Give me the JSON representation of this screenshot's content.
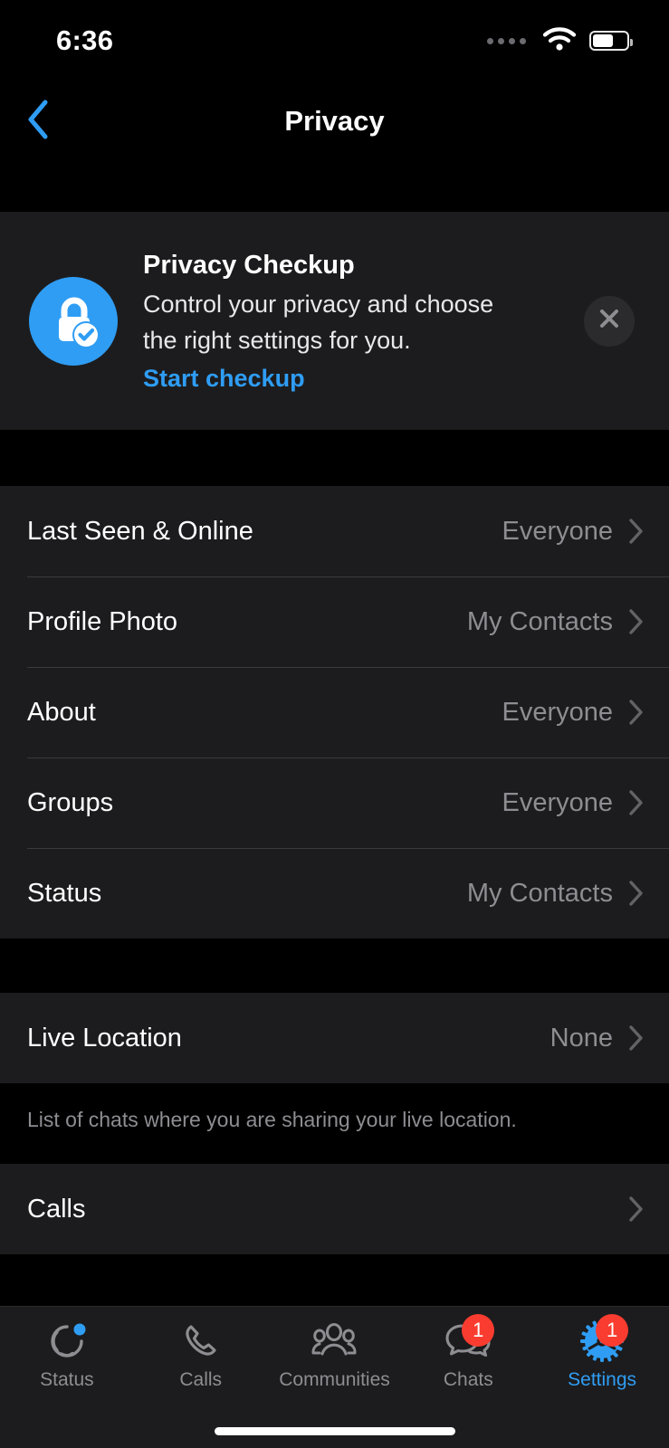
{
  "status_bar": {
    "time": "6:36",
    "signal_icon": "signal-dots-icon",
    "wifi_icon": "wifi-icon",
    "battery_icon": "battery-icon"
  },
  "nav": {
    "back_icon": "chevron-left-icon",
    "title": "Privacy"
  },
  "checkup": {
    "icon": "lock-check-icon",
    "title": "Privacy Checkup",
    "description": "Control your privacy and choose the right settings for you.",
    "link": "Start checkup",
    "close_icon": "close-icon"
  },
  "sections": [
    {
      "rows": [
        {
          "label": "Last Seen & Online",
          "value": "Everyone"
        },
        {
          "label": "Profile Photo",
          "value": "My Contacts"
        },
        {
          "label": "About",
          "value": "Everyone"
        },
        {
          "label": "Groups",
          "value": "Everyone"
        },
        {
          "label": "Status",
          "value": "My Contacts"
        }
      ]
    },
    {
      "rows": [
        {
          "label": "Live Location",
          "value": "None"
        }
      ],
      "footnote": "List of chats where you are sharing your live location."
    },
    {
      "rows": [
        {
          "label": "Calls",
          "value": ""
        }
      ]
    }
  ],
  "tabs": [
    {
      "label": "Status",
      "icon": "status-rings-icon",
      "badge": "",
      "active": false
    },
    {
      "label": "Calls",
      "icon": "phone-icon",
      "badge": "",
      "active": false
    },
    {
      "label": "Communities",
      "icon": "communities-icon",
      "badge": "",
      "active": false
    },
    {
      "label": "Chats",
      "icon": "chats-bubbles-icon",
      "badge": "1",
      "active": false
    },
    {
      "label": "Settings",
      "icon": "gear-icon",
      "badge": "1",
      "active": true
    }
  ],
  "colors": {
    "accent_blue": "#2f9df4",
    "badge_red": "#fa3c30",
    "card_bg": "#1c1c1e",
    "page_bg": "#000000",
    "value_gray": "#8d8d92"
  }
}
